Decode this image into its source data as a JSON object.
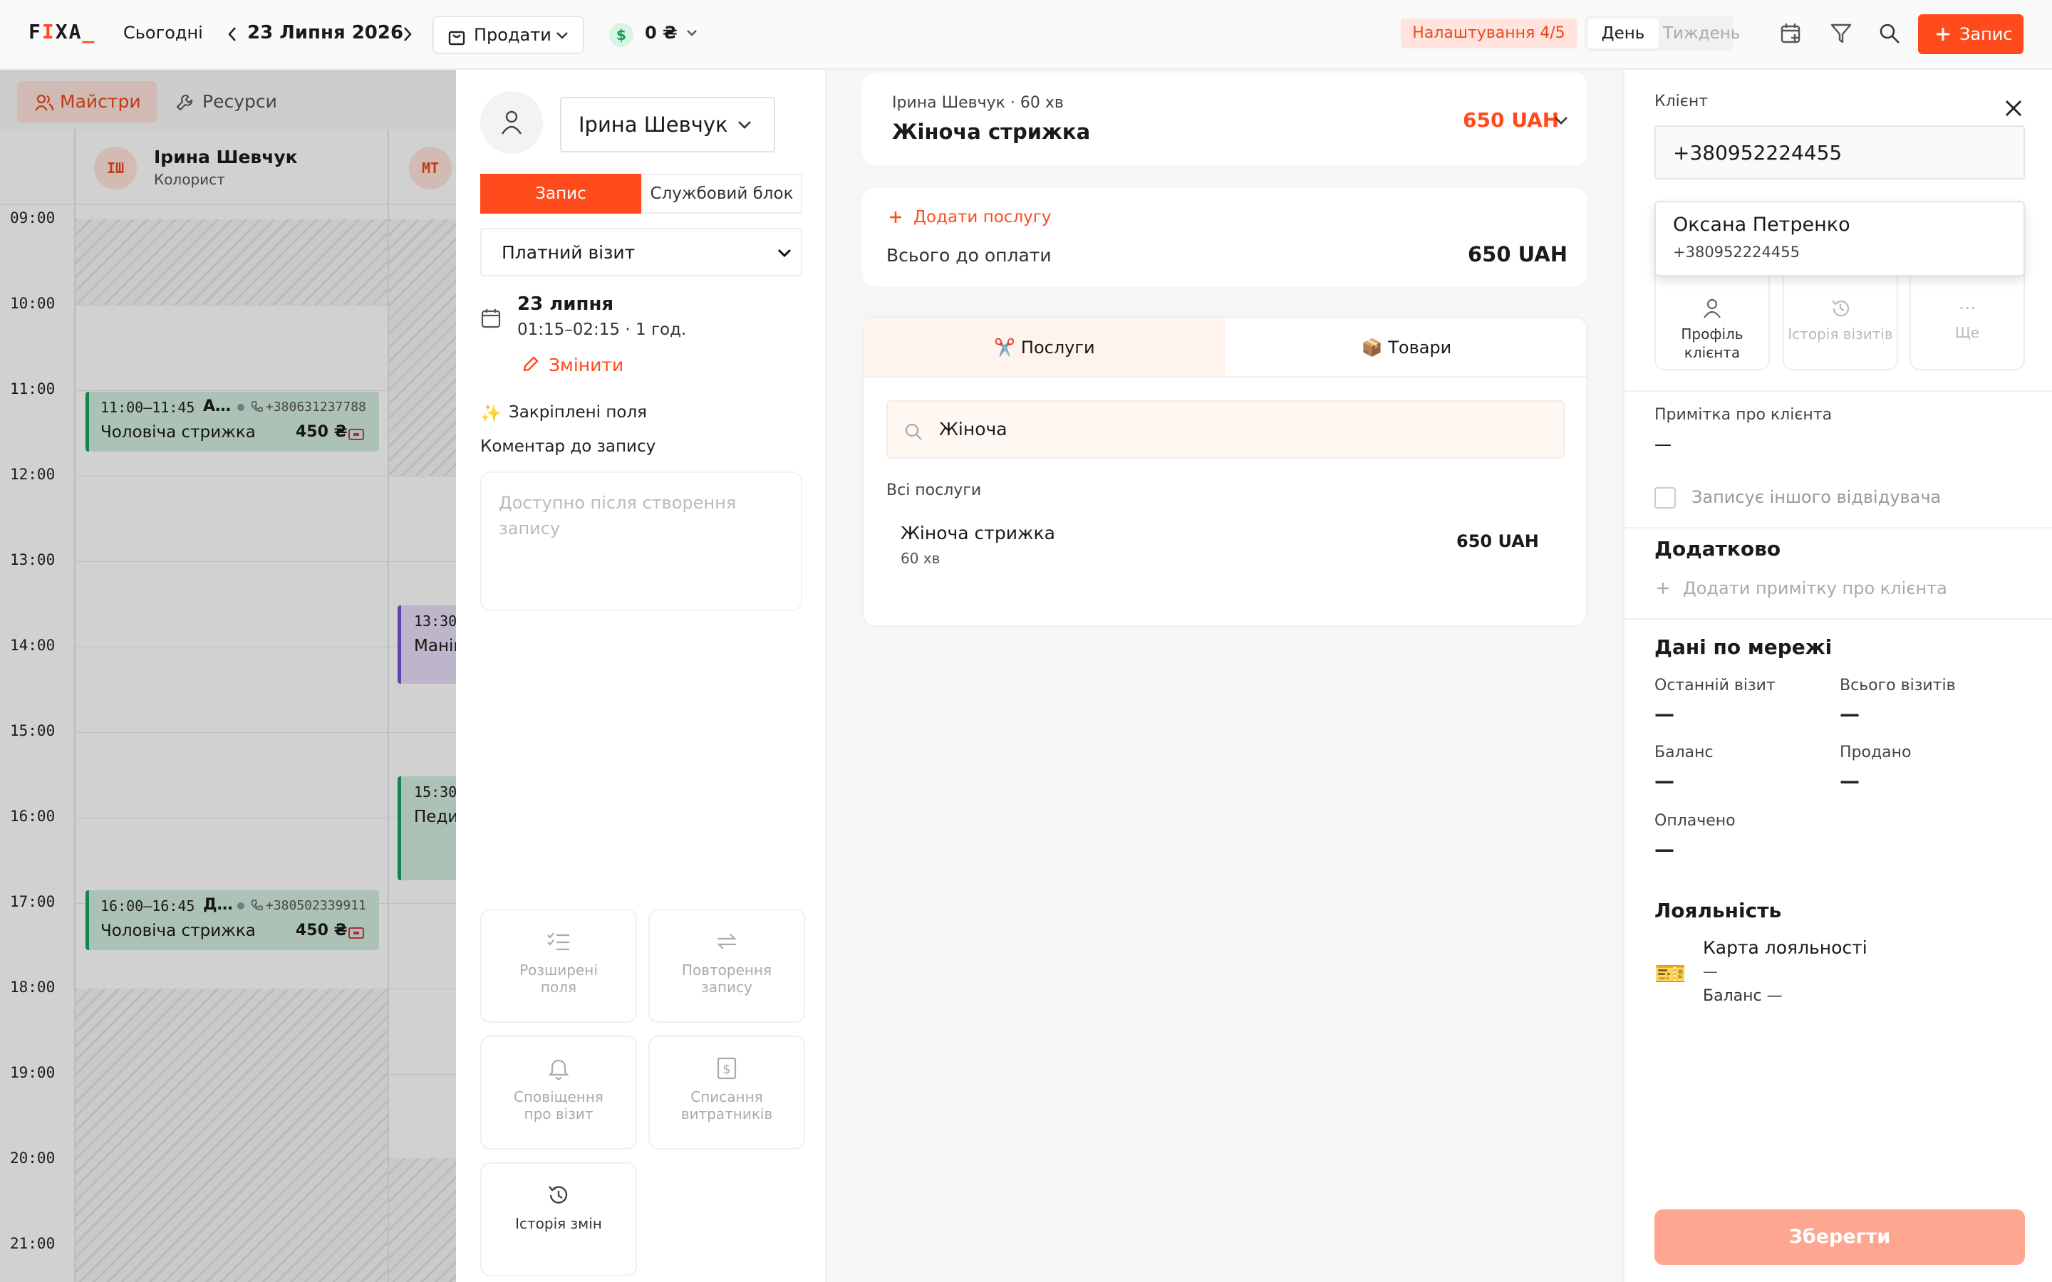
{
  "app": {
    "logo_pre": "F",
    "logo_i": "I",
    "logo_post": "XA",
    "logo_cursor": "_"
  },
  "topbar": {
    "today": "Сьогодні",
    "date": "23 Липня 2026",
    "sell": "Продати",
    "balance": "0 ₴",
    "setup": "Налаштування 4/5",
    "view_day": "День",
    "view_week": "Тиждень",
    "new_booking": "Запис"
  },
  "calendar": {
    "tabs": [
      "Майстри",
      "Ресурси"
    ],
    "masters": [
      {
        "initials": "ІШ",
        "name": "Ірина Шевчук",
        "role": "Колорист"
      },
      {
        "initials": "МТ"
      }
    ],
    "hours": [
      "09:00",
      "10:00",
      "11:00",
      "12:00",
      "13:00",
      "14:00",
      "15:00",
      "16:00",
      "17:00",
      "18:00",
      "19:00",
      "20:00",
      "21:00"
    ],
    "appointments": [
      {
        "time": "11:00–11:45",
        "client": "А…",
        "phone": "+380631237788",
        "service": "Чоловіча стрижка",
        "price": "450 ₴"
      },
      {
        "time": "16:00–16:45",
        "client": "Д…",
        "phone": "+380502339911",
        "service": "Чоловіча стрижка",
        "price": "450 ₴"
      }
    ],
    "col2_appts": [
      {
        "time": "13:30",
        "service": "Манік"
      },
      {
        "time": "15:30",
        "service": "Педи"
      }
    ]
  },
  "form": {
    "master": "Ірина Шевчук",
    "tab_booking": "Запис",
    "tab_block": "Службовий блок",
    "visit_type": "Платний візит",
    "date": "23 липня",
    "time": "01:15–02:15 · 1 год.",
    "change": "Змінити",
    "pinned": "Закріплені поля",
    "comment_label": "Коментар до запису",
    "comment_placeholder": "Доступно після створення запису",
    "buttons": [
      {
        "icon": "checklist-icon",
        "label": "Розширені поля"
      },
      {
        "icon": "repeat-icon",
        "label": "Повторення запису"
      },
      {
        "icon": "bell-icon",
        "label": "Сповіщення про візит"
      },
      {
        "icon": "receipt-icon",
        "label": "Списання витратників"
      },
      {
        "icon": "history-icon",
        "label": "Історія змін"
      }
    ]
  },
  "services": {
    "selected_meta": "Ірина Шевчук · 60 хв",
    "selected_name": "Жіноча стрижка",
    "selected_price": "650 UAH",
    "add_service": "Додати послугу",
    "total_label": "Всього до оплати",
    "total": "650 UAH",
    "tab_services": "✂️ Послуги",
    "tab_goods": "📦 Товари",
    "search_value": "Жіноча",
    "list_title": "Всі послуги",
    "items": [
      {
        "name": "Жіноча стрижка",
        "duration": "60 хв",
        "price": "650 UAH"
      }
    ]
  },
  "client": {
    "label": "Клієнт",
    "phone": "+380952224455",
    "suggestion_name": "Оксана Петренко",
    "suggestion_phone": "+380952224455",
    "actions": [
      "Профіль клієнта",
      "Історія візитів",
      "Ще"
    ],
    "note_label": "Примітка про клієнта",
    "note_value": "—",
    "other_visitor": "Записує іншого відвідувача",
    "extra_title": "Додатково",
    "add_note": "Додати примітку про клієнта",
    "network_title": "Дані по мережі",
    "stats": [
      {
        "label": "Останній візит",
        "value": "—"
      },
      {
        "label": "Всього візитів",
        "value": "—"
      },
      {
        "label": "Баланс",
        "value": "—"
      },
      {
        "label": "Продано",
        "value": "—"
      },
      {
        "label": "Оплачено",
        "value": "—"
      }
    ],
    "loyalty_title": "Лояльність",
    "loyalty_card": "Карта лояльності",
    "loyalty_dash": "—",
    "loyalty_balance": "Баланс —",
    "save": "Зберегти"
  },
  "colors": {
    "accent": "#ff4a1c",
    "appointment_green": "#d4eddf",
    "purple": "#7b4fd6",
    "save_disabled": "#ffa690"
  }
}
